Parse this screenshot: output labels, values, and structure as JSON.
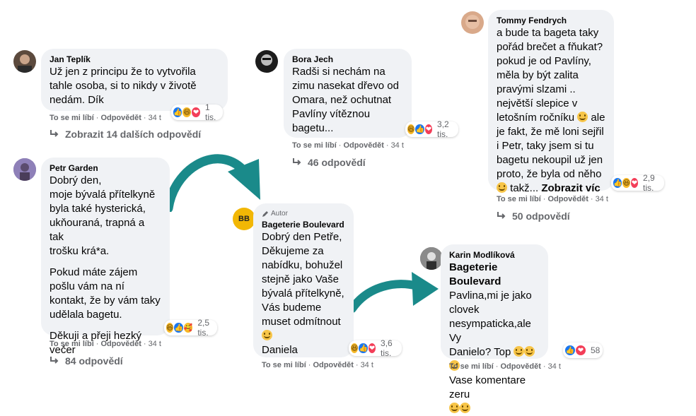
{
  "colors": {
    "accent": "#1a8a8a",
    "bubble": "#f0f2f5",
    "meta_text": "#65676b",
    "like_blue": "#1877f2",
    "love_red": "#f33e58"
  },
  "action_labels": {
    "like": "To se mi líbí",
    "reply": "Odpovědět",
    "age": "34 t",
    "sep": "·"
  },
  "comments": [
    {
      "author": "Jan Teplík",
      "lines": [
        "Už jen z principu že to vytvořila",
        "tahle osoba, si to nikdy v životě",
        "nedám. Dík"
      ],
      "reaction_icons": [
        "like",
        "haha",
        "love"
      ],
      "reaction_count": "1 tis.",
      "replies": "Zobrazit 14 dalších odpovědí"
    },
    {
      "author": "Bora Jech",
      "lines": [
        "Radši si nechám na",
        "zimu nasekat dřevo od",
        "Omara, než ochutnat",
        "Pavlíny vítěznou",
        "bagetu..."
      ],
      "reaction_icons": [
        "haha",
        "like",
        "love"
      ],
      "reaction_count": "3,2 tis.",
      "replies": "46 odpovědí"
    },
    {
      "author": "Tommy Fendrych",
      "lines": [
        "a bude ta bageta taky",
        "pořád brečet a fňukat?",
        "pokud je od Pavlíny,",
        "měla by být zalita",
        "pravými slzami ..",
        "největší slepice v",
        "letošním ročníku",
        "ale je fakt, že mě loni sejřil",
        "i Petr, taky jsem si tu",
        "bagetu nekoupil už jen",
        "proto, že byla od něho",
        "takž..."
      ],
      "see_more": "Zobrazit víc",
      "reaction_icons": [
        "like",
        "haha",
        "love"
      ],
      "reaction_count": "2,9 tis.",
      "replies": "50 odpovědí"
    },
    {
      "author": "Petr Garden",
      "paragraphs": [
        [
          "Dobrý den,",
          "moje bývalá přítelkyně",
          "byla také hysterická,",
          "ukňouraná, trapná a tak",
          "trošku krá*a."
        ],
        [
          "Pokud máte zájem",
          "pošlu vám na ní",
          "kontakt, že by vám taky",
          "udělala bagetu."
        ],
        [
          "Děkuji a přeji hezký",
          "večer"
        ]
      ],
      "reaction_icons": [
        "haha",
        "like",
        "care"
      ],
      "reaction_count": "2,5 tis.",
      "replies": "84 odpovědí"
    },
    {
      "author_tag": "Autor",
      "author": "Bageterie Boulevard",
      "avatar_text": "BB",
      "lines": [
        "Dobrý den Petře,",
        "Děkujeme za",
        "nabídku, bohužel",
        "stejně jako Vaše",
        "bývalá přítelkyně,",
        "Vás budeme",
        "muset odmítnout",
        "",
        "Daniela"
      ],
      "reaction_icons": [
        "haha",
        "like",
        "love"
      ],
      "reaction_count": "3,6 tis."
    },
    {
      "author": "Karin Modlíková",
      "mention": "Bageterie Boulevard",
      "lines": [
        "Pavlina,mi je jako",
        "clovek",
        "nesympaticka,ale Vy",
        "Danielo? Top",
        "Vase komentare zeru",
        ""
      ],
      "reaction_icons": [
        "like",
        "love"
      ],
      "reaction_count": "58"
    }
  ]
}
